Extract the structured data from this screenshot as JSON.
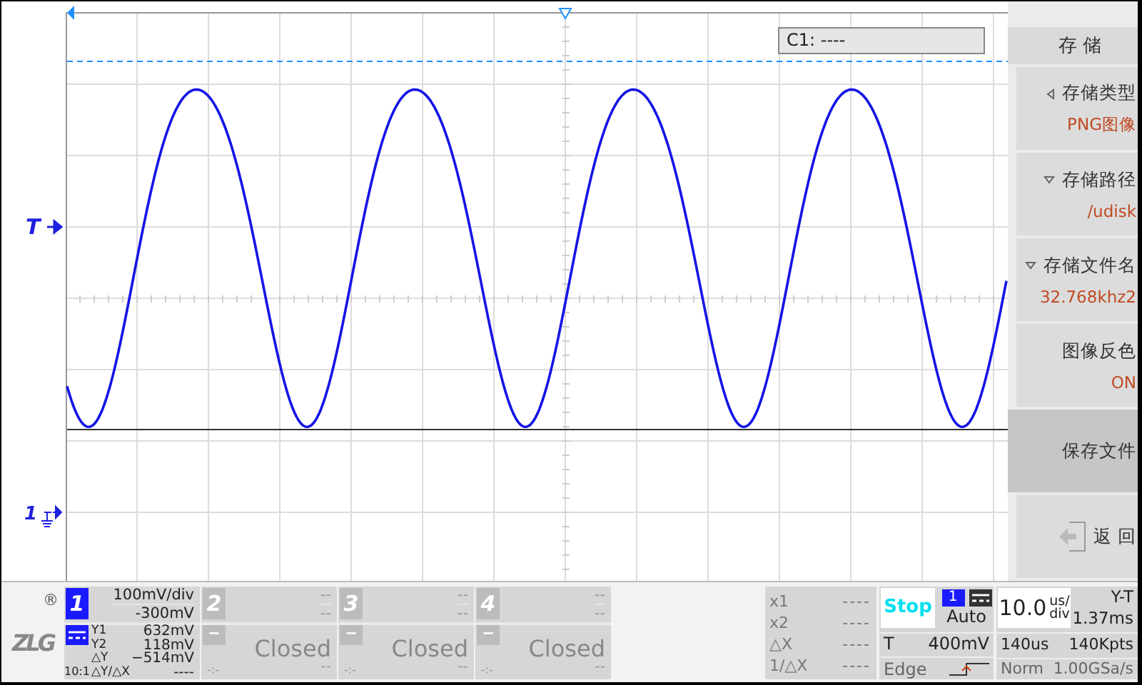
{
  "display": {
    "trigger_marker": "T",
    "channel_marker": "1",
    "cursor_readout": "C1: ----"
  },
  "menu": {
    "title": "存 储",
    "items": [
      {
        "kind": "cycle",
        "label": "存储类型",
        "value": "PNG图像",
        "selected": false
      },
      {
        "kind": "list",
        "label": "存储路径",
        "value": "/udisk",
        "selected": false
      },
      {
        "kind": "list",
        "label": "存储文件名",
        "value": "32.768khz2",
        "selected": false
      },
      {
        "kind": "toggle",
        "label": "图像反色",
        "value": "ON",
        "selected": false
      },
      {
        "kind": "action",
        "label": "保存文件",
        "selected": true
      },
      {
        "kind": "back",
        "label": "返 回",
        "selected": false
      }
    ]
  },
  "logo": {
    "text": "ZLG",
    "mark": "®"
  },
  "channels": [
    {
      "number": "1",
      "on": true,
      "scale": "100mV/div",
      "offset": "-300mV",
      "probe": "10:1",
      "readings": [
        {
          "label": "Y1",
          "value": "632mV"
        },
        {
          "label": "Y2",
          "value": "118mV"
        },
        {
          "label": "△Y",
          "value": "−514mV"
        },
        {
          "label": "△Y/△X",
          "value": "----"
        }
      ]
    },
    {
      "number": "2",
      "on": false,
      "scale": "--",
      "offset": "--",
      "coupling_mark": "−",
      "status": "Closed",
      "position": "-:-",
      "reading": "--"
    },
    {
      "number": "3",
      "on": false,
      "scale": "--",
      "offset": "--",
      "coupling_mark": "−",
      "status": "Closed",
      "position": "-:-",
      "reading": "--"
    },
    {
      "number": "4",
      "on": false,
      "scale": "--",
      "offset": "--",
      "coupling_mark": "−",
      "status": "Closed",
      "position": "-:-",
      "reading": "--"
    }
  ],
  "x_cursors": [
    {
      "label": "x1",
      "value": "----"
    },
    {
      "label": "x2",
      "value": "----"
    },
    {
      "label": "△X",
      "value": "----"
    },
    {
      "label": "1/△X",
      "value": "----"
    }
  ],
  "trigger": {
    "state": "Stop",
    "source": "1",
    "mode": "Auto",
    "threshold_label": "T",
    "threshold": "400mV",
    "type": "Edge"
  },
  "timebase": {
    "scale": "10.0",
    "unit_top": "us/",
    "unit_bottom": "div",
    "mode": "Y-T",
    "position": "1.37ms",
    "window": "140us",
    "depth": "140Kpts",
    "acquisition": "Norm",
    "sample_rate": "1.00GSa/s"
  }
}
